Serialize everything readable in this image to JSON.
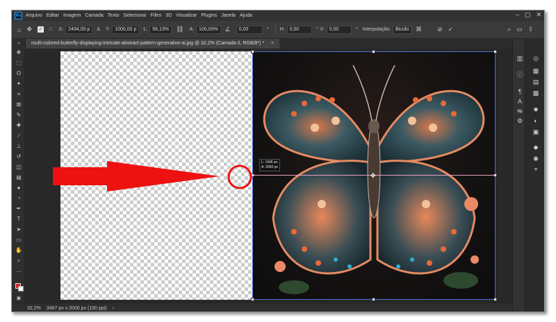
{
  "app": {
    "logo": "Ps"
  },
  "menu": [
    "Arquivo",
    "Editar",
    "Imagem",
    "Camada",
    "Texto",
    "Selecionar",
    "Filtro",
    "3D",
    "Visualizar",
    "Plugins",
    "Janela",
    "Ajuda"
  ],
  "options": {
    "x_label": "X:",
    "x_value": "2494,00 p",
    "y_label": "Y:",
    "y_value": "1000,00 p",
    "w_label": "L:",
    "w_value": "56,13%",
    "h_label": "A:",
    "h_value": "100,00%",
    "angle_value": "0,00",
    "angle_unit": "°",
    "hskew_label": "H:",
    "hskew_value": "0,00",
    "vskew_label": "V:",
    "vskew_value": "0,00",
    "interp_label": "Interpolação:",
    "interp_value": "Bicúbi"
  },
  "document": {
    "tab_title": "multi-colored-butterfly-displaying-intricate-abstract-pattern-generative-ai.jpg @ 32,2% (Camada 0, RGB/8*) *",
    "tab_close": "×"
  },
  "readout": {
    "line1": "L: 1946 px",
    "line2": "A: 2000 px"
  },
  "status": {
    "zoom": "32,2%",
    "doc_info": "3467 px x 2000 px (150 ppi)",
    "chevron": "›"
  },
  "colors": {
    "foreground": "#e01a1a",
    "background": "#ffffff",
    "annotation": "#ee1111"
  },
  "icons": {
    "home": "home-icon",
    "move": "move-tool-icon",
    "link": "link-icon",
    "interp_hint": "warp-icon",
    "cancel": "cancel-icon",
    "commit": "commit-icon"
  }
}
